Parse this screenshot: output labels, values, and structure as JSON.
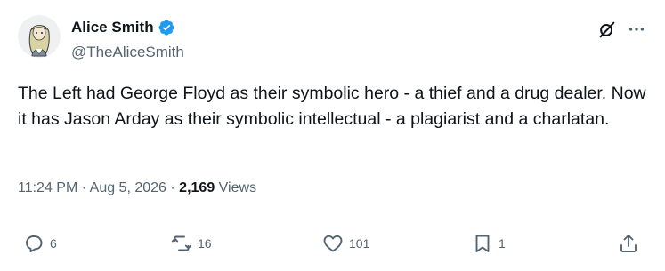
{
  "author": {
    "display_name": "Alice Smith",
    "handle": "@TheAliceSmith",
    "verified": true,
    "verified_color": "#1d9bf0"
  },
  "tweet": {
    "text": "The Left had George Floyd as their symbolic hero - a thief and a drug dealer. Now it has Jason Arday as their symbolic intellectual - a plagiarist and a charlatan.",
    "time": "11:24 PM",
    "separator": "·",
    "date": "Aug 5, 2026",
    "views_count": "2,169",
    "views_label": "Views"
  },
  "actions": {
    "replies": "6",
    "reposts": "16",
    "likes": "101",
    "bookmarks": "1"
  },
  "icons": {
    "avatar": "avatar-illustration",
    "verified": "verified-badge-icon",
    "grok": "grok-icon",
    "more": "more-icon",
    "reply": "reply-icon",
    "repost": "repost-icon",
    "like": "heart-icon",
    "bookmark": "bookmark-icon",
    "share": "share-icon"
  },
  "colors": {
    "text_primary": "#0f1419",
    "text_secondary": "#536471",
    "accent": "#1d9bf0"
  }
}
